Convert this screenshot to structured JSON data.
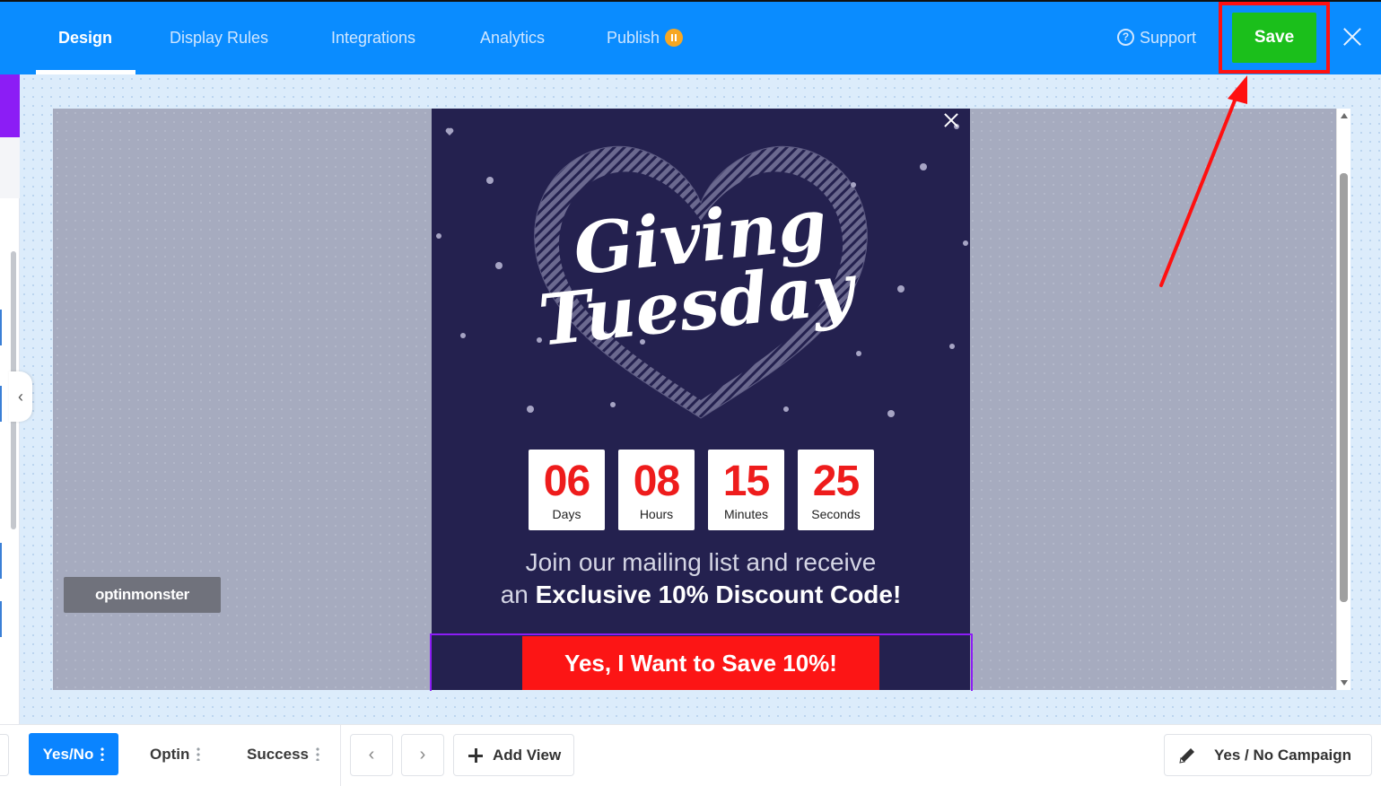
{
  "header": {
    "tabs": [
      {
        "label": "Design",
        "active": true
      },
      {
        "label": "Display Rules",
        "active": false
      },
      {
        "label": "Integrations",
        "active": false
      },
      {
        "label": "Analytics",
        "active": false
      },
      {
        "label": "Publish",
        "active": false,
        "status_icon": "pause-icon"
      }
    ],
    "support_label": "Support",
    "save_label": "Save",
    "close_icon": "close-icon",
    "accent_color": "#0a8cff",
    "save_color": "#1bbf1b",
    "highlight_color": "#ff1010"
  },
  "popup": {
    "headline_line1": "Giving",
    "headline_line2": "Tuesday",
    "countdown": [
      {
        "value": "06",
        "label": "Days"
      },
      {
        "value": "08",
        "label": "Hours"
      },
      {
        "value": "15",
        "label": "Minutes"
      },
      {
        "value": "25",
        "label": "Seconds"
      }
    ],
    "body_line1": "Join our mailing list and receive",
    "body_line2_prefix": "an",
    "body_line2_bold": "Exclusive 10% Discount Code!",
    "cta_label": "Yes, I Want to Save 10%!",
    "background_color": "#24214f",
    "cta_color": "#fc1515"
  },
  "branding": {
    "logo_text": "optinmonster"
  },
  "bottom": {
    "views": [
      {
        "label": "Yes/No",
        "active": true
      },
      {
        "label": "Optin",
        "active": false
      },
      {
        "label": "Success",
        "active": false
      }
    ],
    "add_view_label": "Add View",
    "campaign_name": "Yes / No Campaign"
  }
}
